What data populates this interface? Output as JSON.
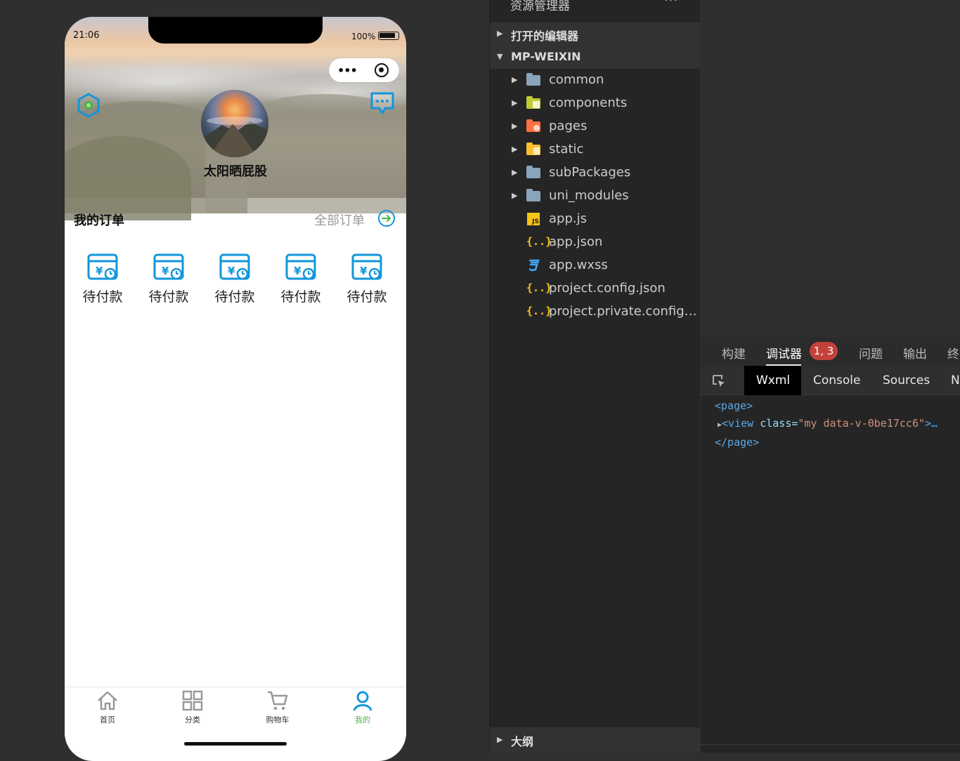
{
  "simulator": {
    "status_time": "21:06",
    "battery": "100%",
    "capsule_menu": "•••",
    "username": "太阳晒屁股",
    "orders_title": "我的订单",
    "all_orders": "全部订单",
    "order_items": [
      {
        "label": "待付款"
      },
      {
        "label": "待付款"
      },
      {
        "label": "待付款"
      },
      {
        "label": "待付款"
      },
      {
        "label": "待付款"
      }
    ],
    "tabs": [
      {
        "label": "首页",
        "icon": "home-icon",
        "active": false
      },
      {
        "label": "分类",
        "icon": "grid-icon",
        "active": false
      },
      {
        "label": "购物车",
        "icon": "cart-icon",
        "active": false
      },
      {
        "label": "我的",
        "icon": "user-icon",
        "active": true
      }
    ],
    "accent_color": "#1296db",
    "active_tab_color": "#44b549"
  },
  "explorer": {
    "title": "资源管理器",
    "more": "···",
    "open_editors": "打开的编辑器",
    "project": "MP-WEIXIN",
    "items": [
      {
        "name": "common",
        "type": "folder"
      },
      {
        "name": "components",
        "type": "folder"
      },
      {
        "name": "pages",
        "type": "folder"
      },
      {
        "name": "static",
        "type": "folder"
      },
      {
        "name": "subPackages",
        "type": "folder"
      },
      {
        "name": "uni_modules",
        "type": "folder"
      },
      {
        "name": "app.js",
        "type": "js"
      },
      {
        "name": "app.json",
        "type": "json"
      },
      {
        "name": "app.wxss",
        "type": "css"
      },
      {
        "name": "project.config.json",
        "type": "json"
      },
      {
        "name": "project.private.config.js...",
        "type": "json"
      }
    ],
    "outline": "大纲"
  },
  "devtools": {
    "tabs": [
      "构建",
      "调试器",
      "问题",
      "输出",
      "终"
    ],
    "badge": "1, 3",
    "subtabs": [
      "Wxml",
      "Console",
      "Sources",
      "N"
    ],
    "code": {
      "line1": "<page>",
      "line2_tag": "<view",
      "line2_attr": " class=",
      "line2_val": "\"my data-v-0be17cc6\"",
      "line2_end": ">…",
      "line3": "</page>"
    }
  }
}
